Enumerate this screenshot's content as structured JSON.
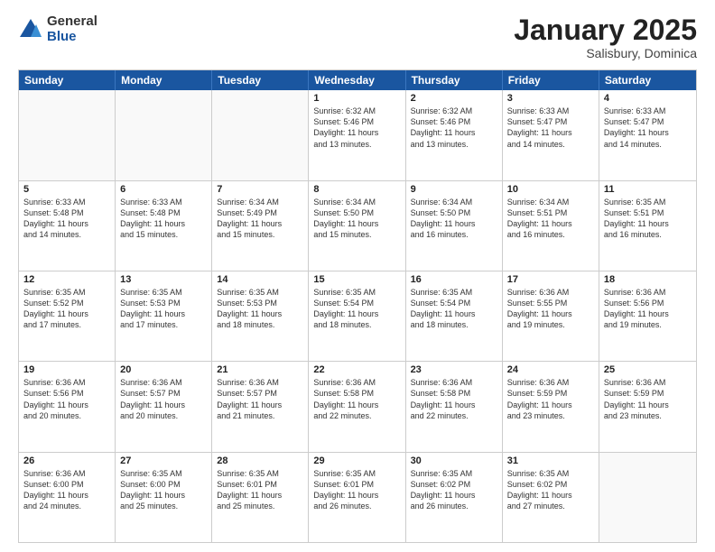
{
  "logo": {
    "general": "General",
    "blue": "Blue"
  },
  "title": "January 2025",
  "subtitle": "Salisbury, Dominica",
  "days": [
    "Sunday",
    "Monday",
    "Tuesday",
    "Wednesday",
    "Thursday",
    "Friday",
    "Saturday"
  ],
  "weeks": [
    [
      {
        "day": "",
        "text": "",
        "empty": true
      },
      {
        "day": "",
        "text": "",
        "empty": true
      },
      {
        "day": "",
        "text": "",
        "empty": true
      },
      {
        "day": "1",
        "text": "Sunrise: 6:32 AM\nSunset: 5:46 PM\nDaylight: 11 hours\nand 13 minutes."
      },
      {
        "day": "2",
        "text": "Sunrise: 6:32 AM\nSunset: 5:46 PM\nDaylight: 11 hours\nand 13 minutes."
      },
      {
        "day": "3",
        "text": "Sunrise: 6:33 AM\nSunset: 5:47 PM\nDaylight: 11 hours\nand 14 minutes."
      },
      {
        "day": "4",
        "text": "Sunrise: 6:33 AM\nSunset: 5:47 PM\nDaylight: 11 hours\nand 14 minutes."
      }
    ],
    [
      {
        "day": "5",
        "text": "Sunrise: 6:33 AM\nSunset: 5:48 PM\nDaylight: 11 hours\nand 14 minutes."
      },
      {
        "day": "6",
        "text": "Sunrise: 6:33 AM\nSunset: 5:48 PM\nDaylight: 11 hours\nand 15 minutes."
      },
      {
        "day": "7",
        "text": "Sunrise: 6:34 AM\nSunset: 5:49 PM\nDaylight: 11 hours\nand 15 minutes."
      },
      {
        "day": "8",
        "text": "Sunrise: 6:34 AM\nSunset: 5:50 PM\nDaylight: 11 hours\nand 15 minutes."
      },
      {
        "day": "9",
        "text": "Sunrise: 6:34 AM\nSunset: 5:50 PM\nDaylight: 11 hours\nand 16 minutes."
      },
      {
        "day": "10",
        "text": "Sunrise: 6:34 AM\nSunset: 5:51 PM\nDaylight: 11 hours\nand 16 minutes."
      },
      {
        "day": "11",
        "text": "Sunrise: 6:35 AM\nSunset: 5:51 PM\nDaylight: 11 hours\nand 16 minutes."
      }
    ],
    [
      {
        "day": "12",
        "text": "Sunrise: 6:35 AM\nSunset: 5:52 PM\nDaylight: 11 hours\nand 17 minutes."
      },
      {
        "day": "13",
        "text": "Sunrise: 6:35 AM\nSunset: 5:53 PM\nDaylight: 11 hours\nand 17 minutes."
      },
      {
        "day": "14",
        "text": "Sunrise: 6:35 AM\nSunset: 5:53 PM\nDaylight: 11 hours\nand 18 minutes."
      },
      {
        "day": "15",
        "text": "Sunrise: 6:35 AM\nSunset: 5:54 PM\nDaylight: 11 hours\nand 18 minutes."
      },
      {
        "day": "16",
        "text": "Sunrise: 6:35 AM\nSunset: 5:54 PM\nDaylight: 11 hours\nand 18 minutes."
      },
      {
        "day": "17",
        "text": "Sunrise: 6:36 AM\nSunset: 5:55 PM\nDaylight: 11 hours\nand 19 minutes."
      },
      {
        "day": "18",
        "text": "Sunrise: 6:36 AM\nSunset: 5:56 PM\nDaylight: 11 hours\nand 19 minutes."
      }
    ],
    [
      {
        "day": "19",
        "text": "Sunrise: 6:36 AM\nSunset: 5:56 PM\nDaylight: 11 hours\nand 20 minutes."
      },
      {
        "day": "20",
        "text": "Sunrise: 6:36 AM\nSunset: 5:57 PM\nDaylight: 11 hours\nand 20 minutes."
      },
      {
        "day": "21",
        "text": "Sunrise: 6:36 AM\nSunset: 5:57 PM\nDaylight: 11 hours\nand 21 minutes."
      },
      {
        "day": "22",
        "text": "Sunrise: 6:36 AM\nSunset: 5:58 PM\nDaylight: 11 hours\nand 22 minutes."
      },
      {
        "day": "23",
        "text": "Sunrise: 6:36 AM\nSunset: 5:58 PM\nDaylight: 11 hours\nand 22 minutes."
      },
      {
        "day": "24",
        "text": "Sunrise: 6:36 AM\nSunset: 5:59 PM\nDaylight: 11 hours\nand 23 minutes."
      },
      {
        "day": "25",
        "text": "Sunrise: 6:36 AM\nSunset: 5:59 PM\nDaylight: 11 hours\nand 23 minutes."
      }
    ],
    [
      {
        "day": "26",
        "text": "Sunrise: 6:36 AM\nSunset: 6:00 PM\nDaylight: 11 hours\nand 24 minutes."
      },
      {
        "day": "27",
        "text": "Sunrise: 6:35 AM\nSunset: 6:00 PM\nDaylight: 11 hours\nand 25 minutes."
      },
      {
        "day": "28",
        "text": "Sunrise: 6:35 AM\nSunset: 6:01 PM\nDaylight: 11 hours\nand 25 minutes."
      },
      {
        "day": "29",
        "text": "Sunrise: 6:35 AM\nSunset: 6:01 PM\nDaylight: 11 hours\nand 26 minutes."
      },
      {
        "day": "30",
        "text": "Sunrise: 6:35 AM\nSunset: 6:02 PM\nDaylight: 11 hours\nand 26 minutes."
      },
      {
        "day": "31",
        "text": "Sunrise: 6:35 AM\nSunset: 6:02 PM\nDaylight: 11 hours\nand 27 minutes."
      },
      {
        "day": "",
        "text": "",
        "empty": true
      }
    ]
  ]
}
